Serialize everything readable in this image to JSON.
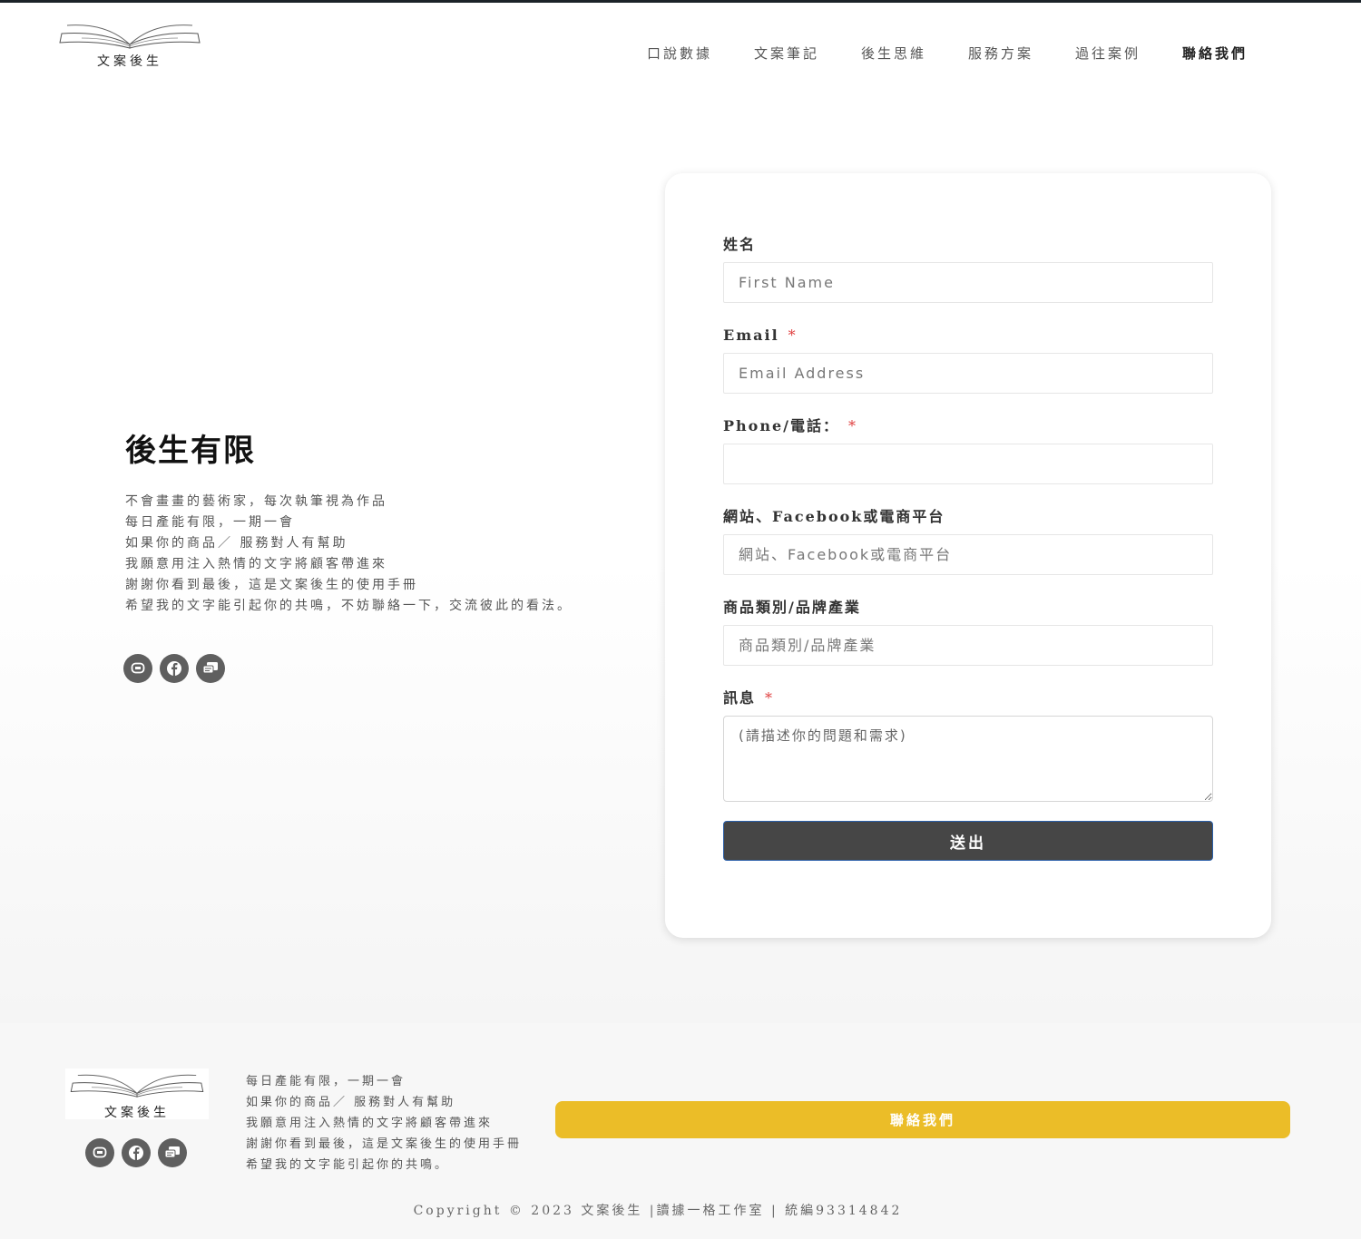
{
  "header": {
    "logo_text": "文案後生",
    "nav": [
      {
        "label": "口說數據"
      },
      {
        "label": "文案筆記"
      },
      {
        "label": "後生思維"
      },
      {
        "label": "服務方案"
      },
      {
        "label": "過往案例"
      },
      {
        "label": "聯絡我們",
        "active": true
      }
    ]
  },
  "intro": {
    "title": "後生有限",
    "lines": [
      "不會畫畫的藝術家，每次執筆視為作品",
      "每日產能有限，一期一會",
      "如果你的商品／ 服務對人有幫助",
      "我願意用注入熱情的文字將顧客帶進來",
      "謝謝你看到最後，這是文案後生的使用手冊",
      "希望我的文字能引起你的共鳴，不妨聯絡一下，交流彼此的看法。"
    ]
  },
  "social_icons": [
    "line-icon",
    "facebook-icon",
    "message-icon"
  ],
  "form": {
    "name_label": "姓名",
    "name_placeholder": "First Name",
    "email_label": "Email",
    "email_placeholder": "Email Address",
    "phone_label": "Phone/電話：",
    "phone_placeholder": "",
    "website_label": "網站、Facebook或電商平台",
    "website_placeholder": "網站、Facebook或電商平台",
    "category_label": "商品類別/品牌產業",
    "category_placeholder": "商品類別/品牌產業",
    "message_label": "訊息",
    "message_placeholder": "(請描述你的問題和需求)",
    "required_mark": "*",
    "submit_label": "送出"
  },
  "footer": {
    "logo_text": "文案後生",
    "lines": [
      "每日產能有限，一期一會",
      "如果你的商品／ 服務對人有幫助",
      "我願意用注入熱情的文字將顧客帶進來",
      "謝謝你看到最後，這是文案後生的使用手冊",
      "希望我的文字能引起你的共鳴。"
    ],
    "contact_button": "聯絡我們",
    "copyright": "Copyright © 2023 文案後生 |讀據一格工作室 | 統編93314842"
  },
  "colors": {
    "accent": "#ebbd28",
    "submit_bg": "#464646",
    "required": "#e04040",
    "icon_bg": "#5f5f5f"
  }
}
